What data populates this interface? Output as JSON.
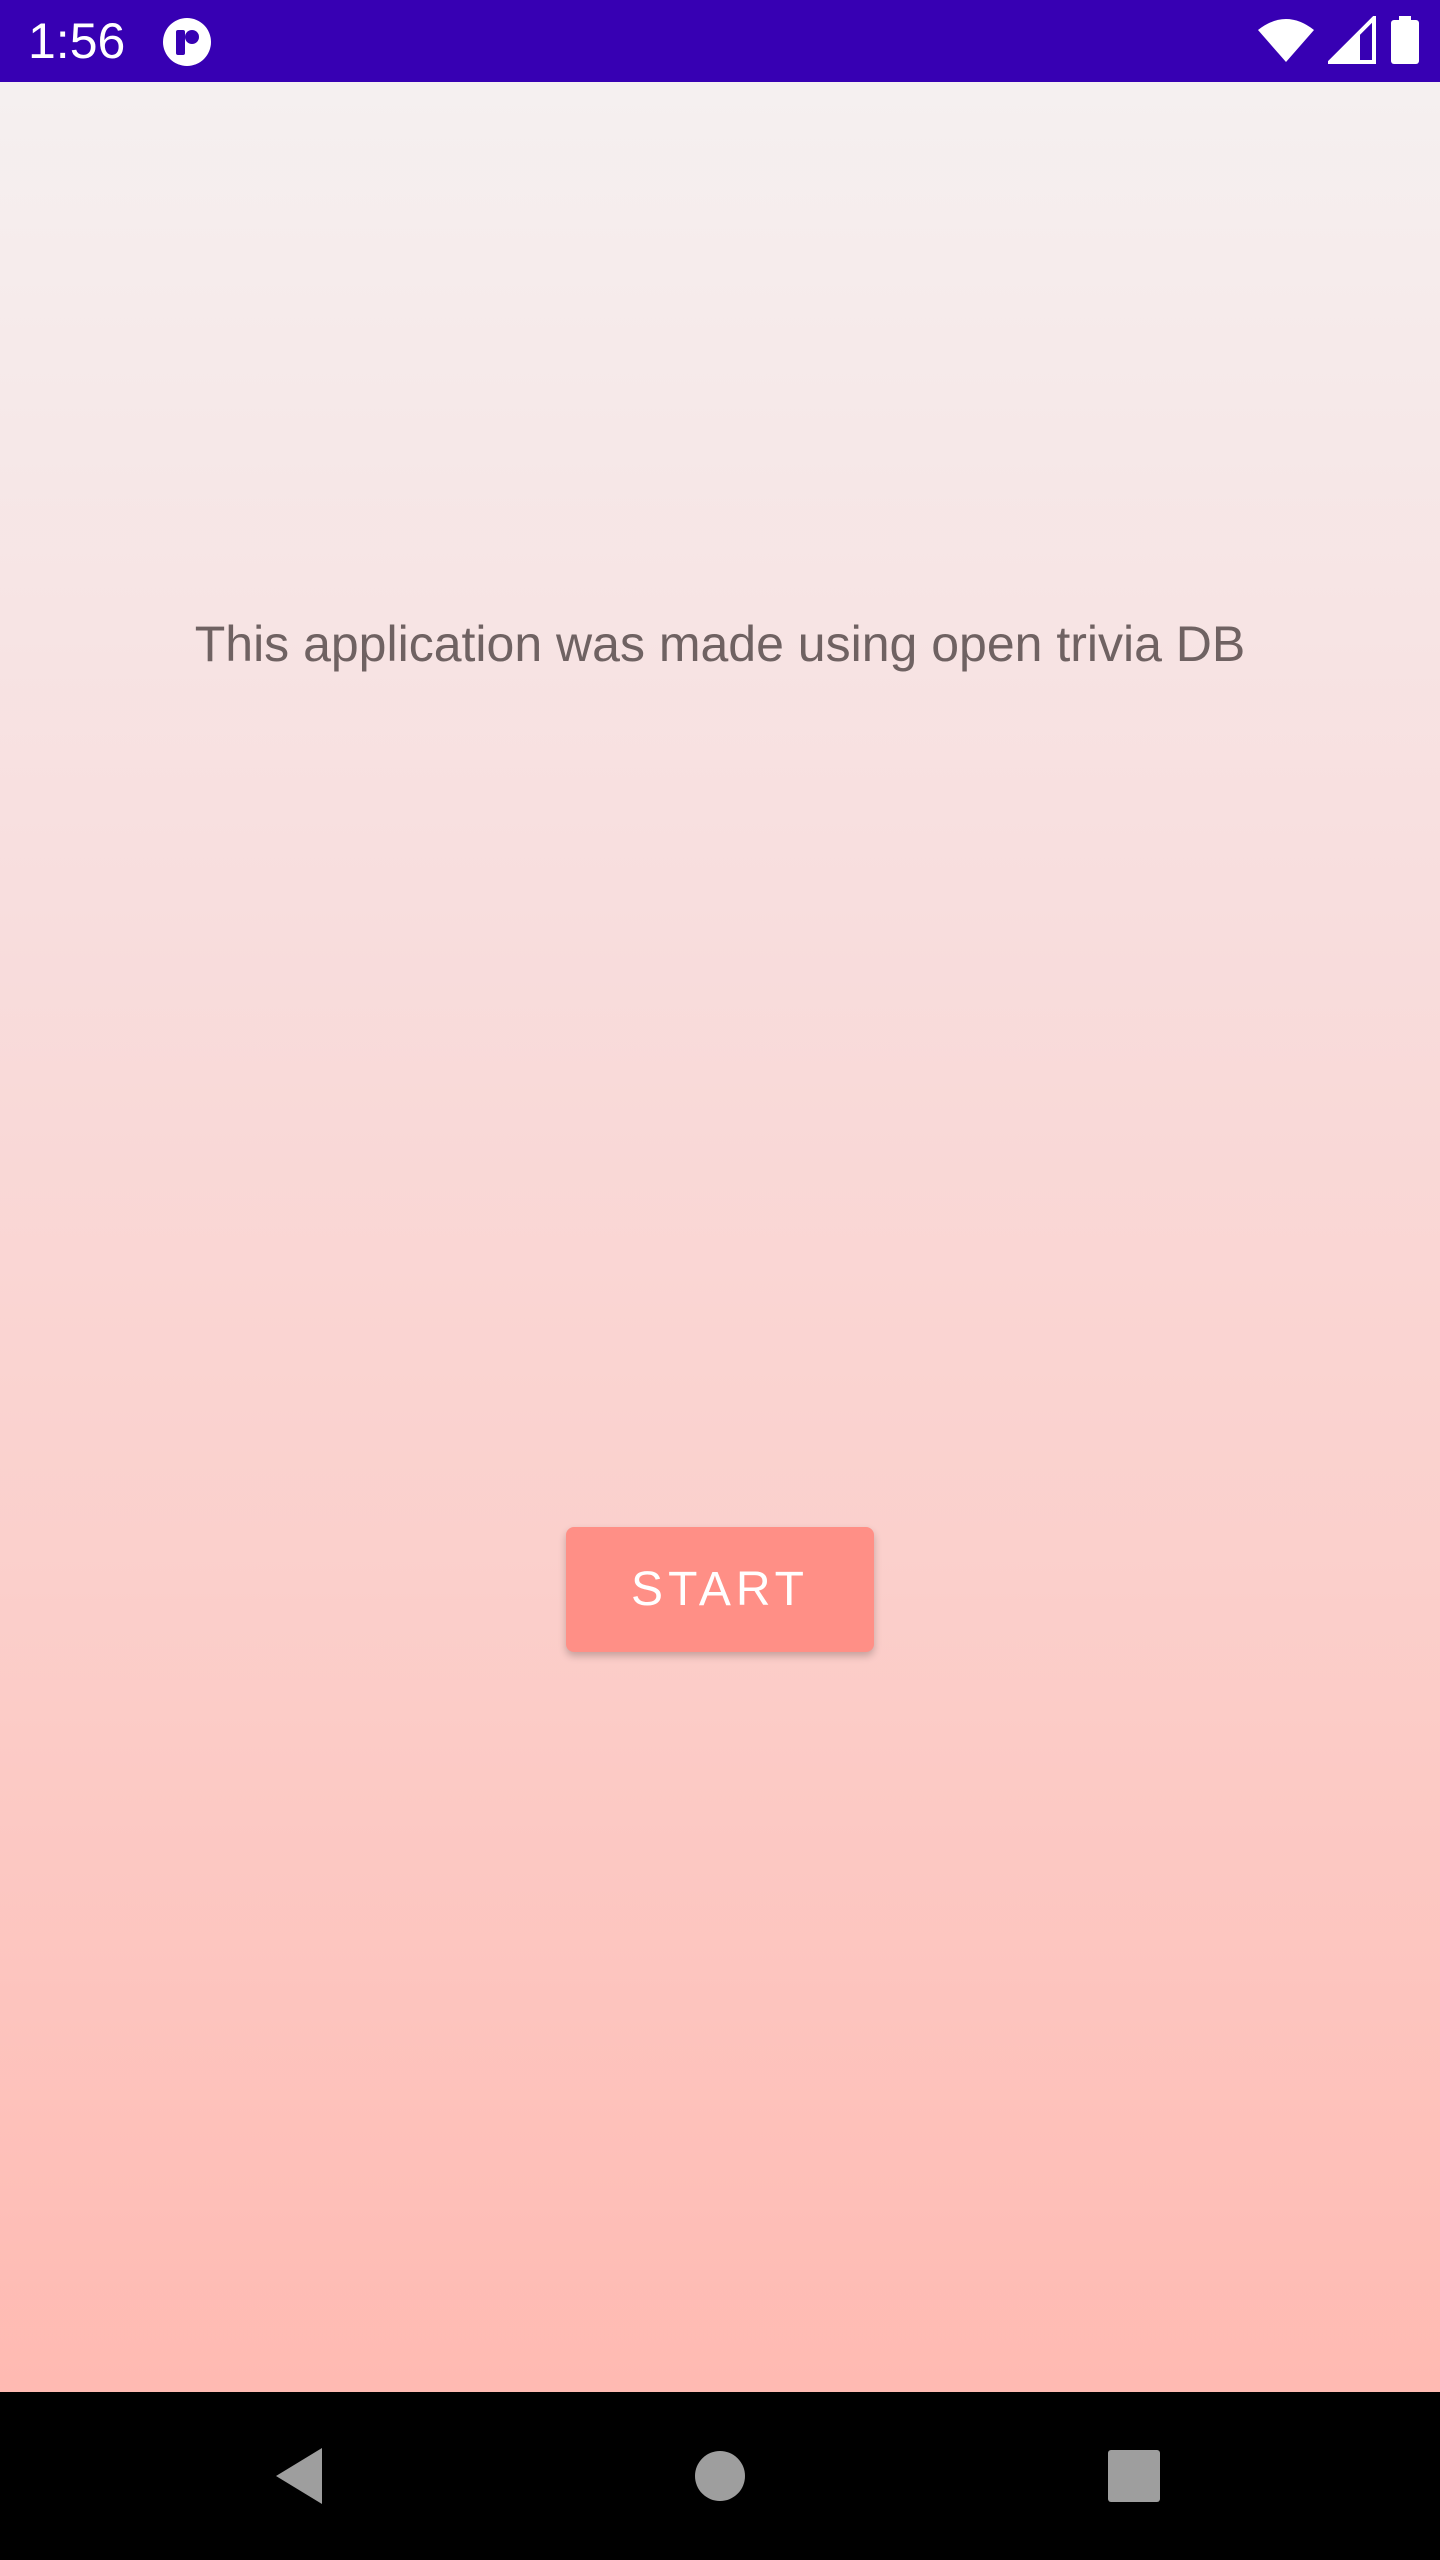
{
  "status_bar": {
    "time": "1:56",
    "background_color": "#3700b3",
    "icons": [
      "app-notification-icon",
      "wifi-icon",
      "cell-signal-icon",
      "battery-icon"
    ]
  },
  "main": {
    "credit_text": "This application was made using open trivia DB",
    "start_button_label": "START",
    "start_button_color": "#ff8f86"
  },
  "nav_bar": {
    "icons": [
      "back-icon",
      "home-icon",
      "recents-icon"
    ]
  }
}
